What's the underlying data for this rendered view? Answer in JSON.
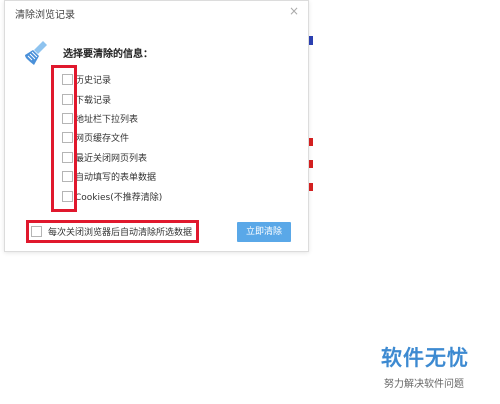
{
  "dialog": {
    "title": "清除浏览记录",
    "close_glyph": "×",
    "heading": "选择要清除的信息：",
    "options": [
      {
        "label": "历史记录",
        "checked": false
      },
      {
        "label": "下载记录",
        "checked": false
      },
      {
        "label": "地址栏下拉列表",
        "checked": false
      },
      {
        "label": "网页缓存文件",
        "checked": false
      },
      {
        "label": "最近关闭网页列表",
        "checked": false
      },
      {
        "label": "自动填写的表单数据",
        "checked": false
      },
      {
        "label": "Cookies(不推荐清除)",
        "checked": false
      }
    ],
    "auto_clear_label": "每次关闭浏览器后自动清除所选数据",
    "auto_clear_checked": false,
    "clear_button": "立即清除"
  },
  "watermark": {
    "title": "软件无忧",
    "subtitle": "努力解决软件问题"
  },
  "colors": {
    "highlight": "#e0182d",
    "button_bg": "#5aa8e8",
    "watermark_blue": "#3d8ad1"
  },
  "icons": [
    "broom-icon",
    "close-icon",
    "checkbox-icon"
  ]
}
